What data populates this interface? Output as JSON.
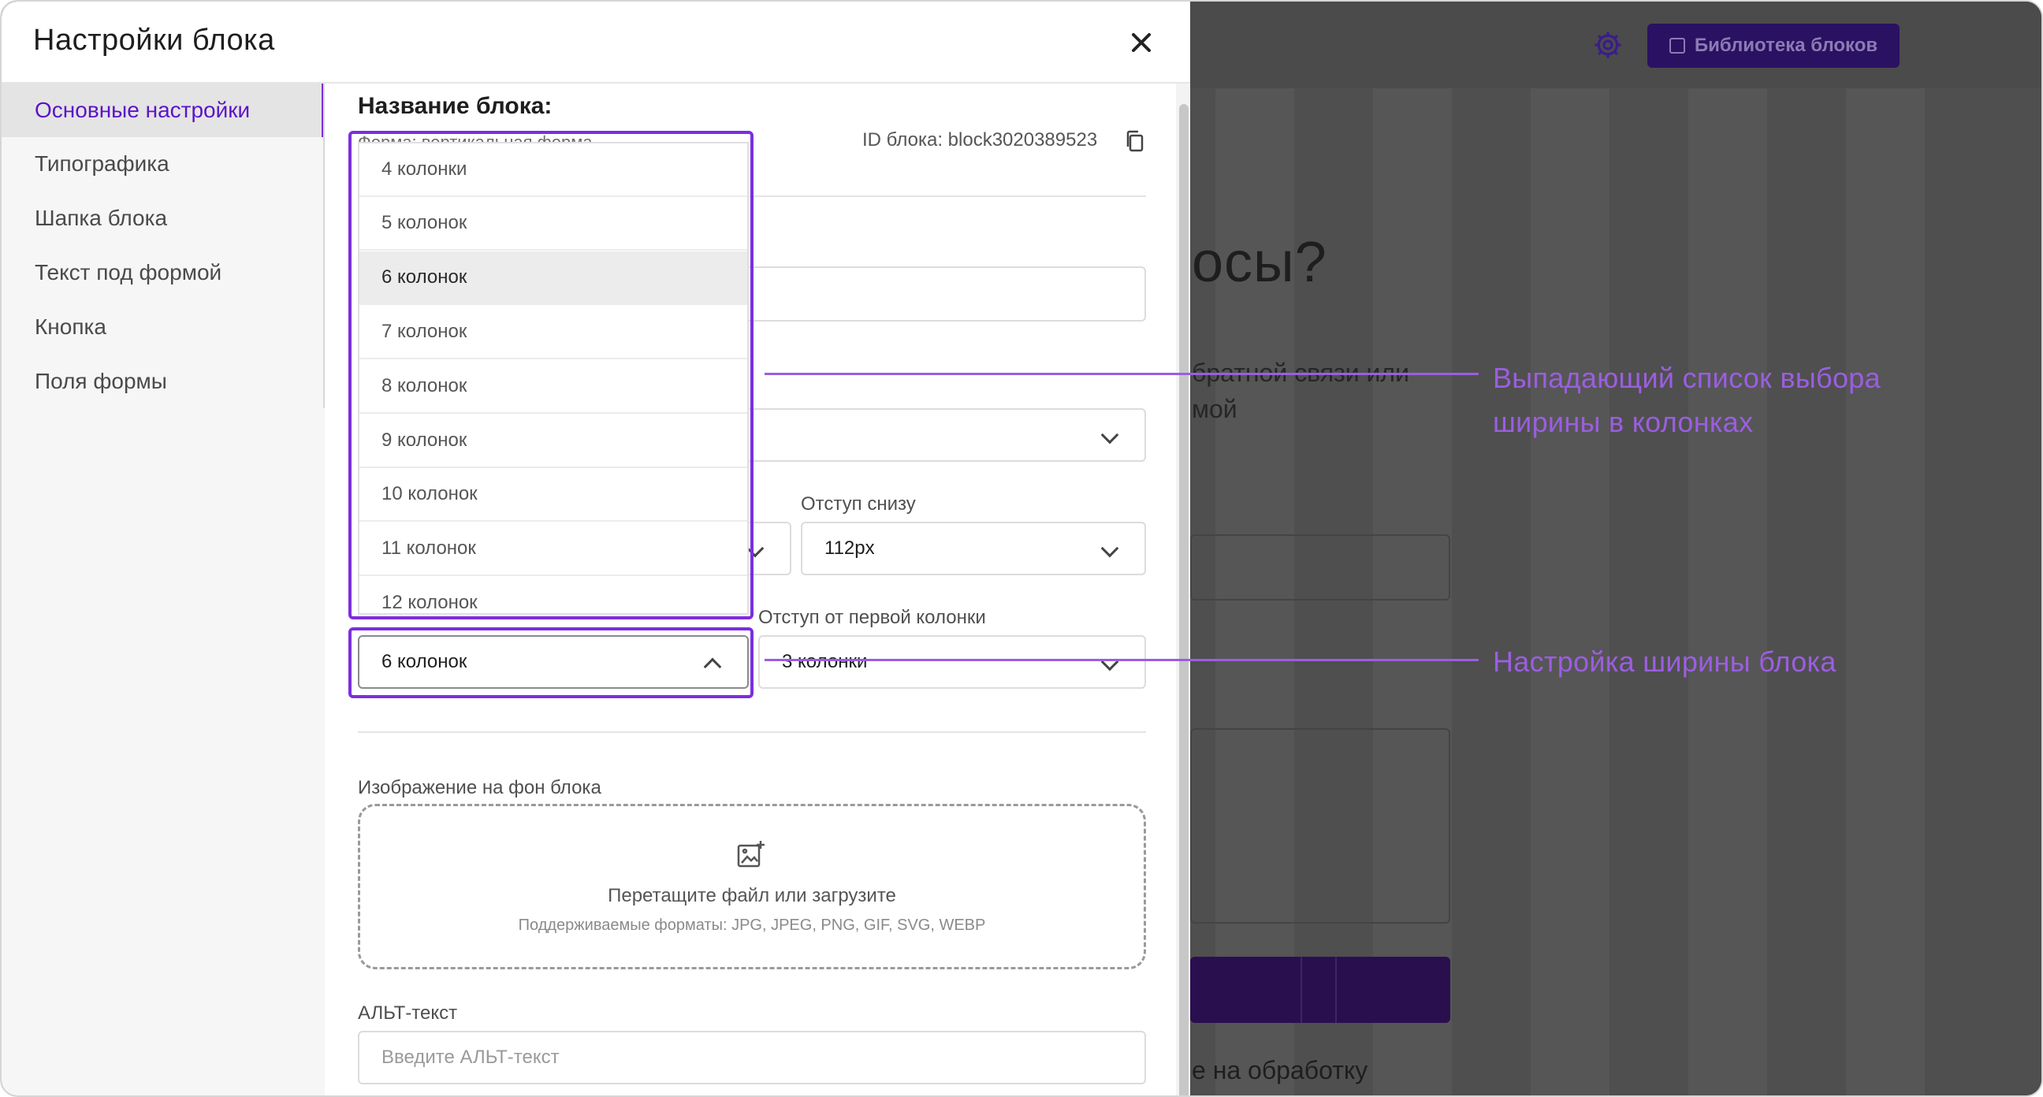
{
  "background": {
    "library_button": "Библиотека блоков",
    "heading_fragment": "осы?",
    "text_fragment_line1": "братной связи или",
    "text_fragment_line2": "мой",
    "consent_fragment": "е на обработку"
  },
  "modal": {
    "title": "Настройки блока",
    "sidebar": {
      "items": [
        {
          "label": "Основные настройки",
          "active": true
        },
        {
          "label": "Типографика"
        },
        {
          "label": "Шапка блока"
        },
        {
          "label": "Текст под формой"
        },
        {
          "label": "Кнопка"
        },
        {
          "label": "Поля формы"
        }
      ]
    },
    "content": {
      "section_title": "Название блока:",
      "subtitle": "Форма: вертикальная форма",
      "block_id": "ID блока: block3020389523",
      "padding_bottom_label": "Отступ снизу",
      "padding_bottom_value": "112px",
      "first_column_offset_label": "Отступ от первой колонки",
      "first_column_offset_value": "3 колонки",
      "width_select_value": "6 колонок",
      "width_options": [
        "4 колонки",
        "5 колонок",
        "6 колонок",
        "7 колонок",
        "8 колонок",
        "9 колонок",
        "10 колонок",
        "11 колонок",
        "12 колонок"
      ],
      "selected_option_index": 2,
      "bg_image_label": "Изображение на фон блока",
      "upload_main": "Перетащите файл или загрузите",
      "upload_sub": "Поддерживаемые форматы: JPG, JPEG, PNG, GIF, SVG, WEBP",
      "alt_label": "АЛЬТ-текст",
      "alt_placeholder": "Введите АЛЬТ-текст"
    }
  },
  "annotations": {
    "dropdown_callout_line1": "Выпадающий список выбора",
    "dropdown_callout_line2": "ширины в колонках",
    "width_callout": "Настройка ширины блока"
  },
  "colors": {
    "accent": "#7c2ee0",
    "callout": "#9b5ee0",
    "active_nav": "#5b14c8",
    "overlay": "#4f4f4f"
  },
  "icons": [
    "close-icon",
    "copy-icon",
    "chevron-down-icon",
    "chevron-up-icon",
    "image-add-icon",
    "gear-icon",
    "library-icon"
  ]
}
